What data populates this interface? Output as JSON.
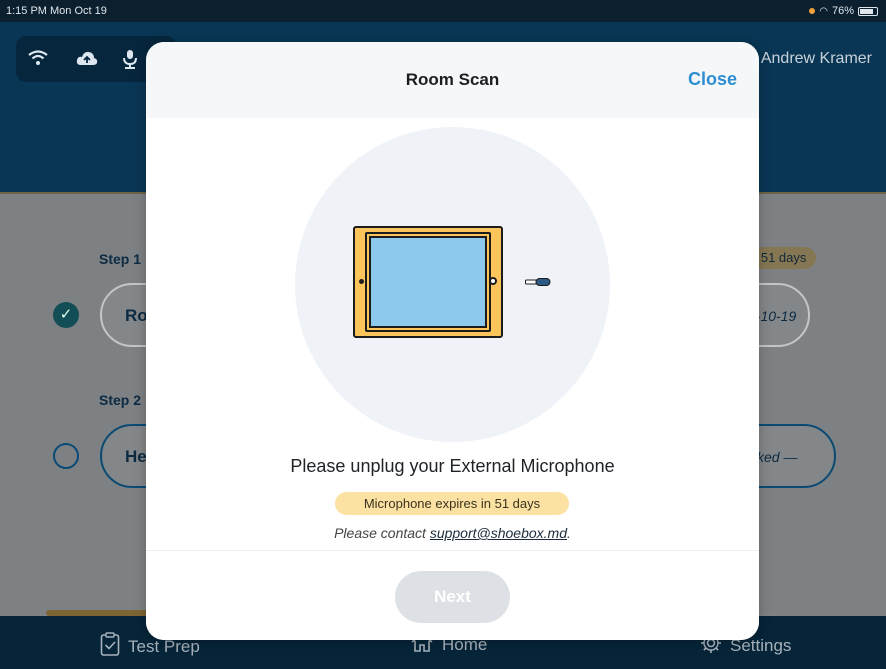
{
  "status_bar": {
    "time": "1:15 PM  Mon Oct 19",
    "battery": "76%"
  },
  "header": {
    "user_name": "Andrew Kramer",
    "icons": [
      "wifi-icon",
      "cloud-upload-icon",
      "microphone-icon"
    ]
  },
  "steps": [
    {
      "label": "Step 1",
      "title_partial": "Ro",
      "date_partial": "0-10-19",
      "badge_partial": "n 51 days",
      "completed": true
    },
    {
      "label": "Step 2",
      "title_partial": "He",
      "status_partial": "cked —",
      "completed": false
    }
  ],
  "tabbar": {
    "tabs": [
      {
        "label": "Test Prep",
        "icon": "clipboard-check-icon"
      },
      {
        "label": "Home",
        "icon": "home-icon"
      },
      {
        "label": "Settings",
        "icon": "gear-icon"
      }
    ]
  },
  "modal": {
    "title": "Room Scan",
    "close_label": "Close",
    "instruction": "Please unplug your External Microphone",
    "expire_badge": "Microphone expires in 51 days",
    "contact_prefix": "Please contact ",
    "contact_email": "support@shoebox.md",
    "contact_suffix": ".",
    "next_label": "Next"
  },
  "colors": {
    "accent": "#2d8fd2",
    "header": "#093654",
    "badge": "#fbe2a3",
    "tablet": "#fcc55c",
    "screen": "#8cc9ec"
  }
}
